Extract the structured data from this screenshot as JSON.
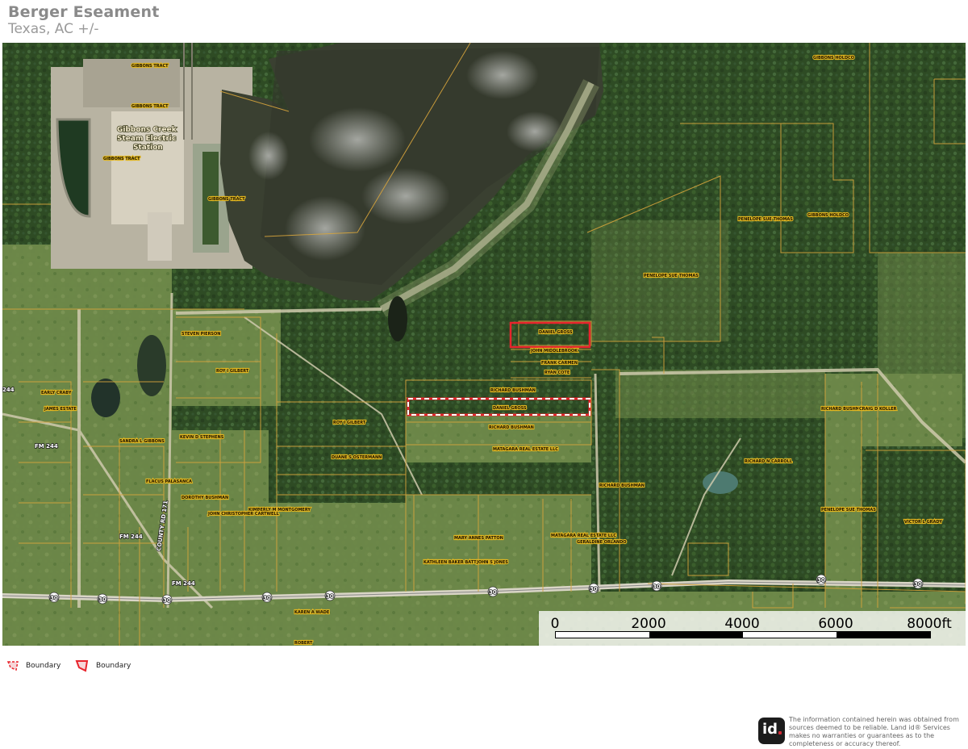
{
  "header": {
    "title": "Berger Eseament",
    "subtitle": "Texas,  AC +/-"
  },
  "map": {
    "place_labels": [
      "Gibbons Creek",
      "Steam Electric",
      "Station"
    ],
    "road_labels": [
      "FM 244",
      "FM 244",
      "FM 244",
      "COUNTY RD 171",
      "244",
      "30",
      "30",
      "30",
      "30",
      "30",
      "30",
      "30",
      "30",
      "30",
      "30"
    ],
    "parcel_labels": [
      "GIBBONS TRACT",
      "GIBBONS TRACT",
      "GIBBONS TRACT",
      "GIBBONS TRACT",
      "GIBBONS HOLDCO",
      "GIBBONS HOLDCO",
      "PENELOPE SUE THOMAS",
      "PENELOPE SUE THOMAS",
      "DANIEL GROSS",
      "JOHN MIDDLEBROOK",
      "FRANK CARMEN",
      "RYAN COTE",
      "RICHARD BUSHMAN",
      "DANIEL GROSS",
      "RICHARD BUSHMAN",
      "ROY I GILBERT",
      "MATAGARA REAL ESTATE LLC",
      "DUANE S OSTERMANN",
      "RICHARD BUSHMAN",
      "STEVEN PIERSON",
      "ROY I GILBERT",
      "KEVIN D STEPHENS",
      "JAMES ESTATE",
      "EARLY CRABY",
      "SANDRA L GIBBONS",
      "FLACUS PALASANCA",
      "KIMBERLY M MONTGOMERY",
      "JOHN CHRISTOPHER CARTWELL",
      "DOROTHY BUSHMAN",
      "GERALDINE ORLANDO",
      "MARY ANNES PATTON",
      "KATHLEEN BAKER BATTERFIELD",
      "JOHN S JONES",
      "MATAGARA REAL ESTATE LLC",
      "RICHARD N CARROLL",
      "RICHARD BUSHMAN",
      "CRAIG D KOLLER",
      "PENELOPE SUE THOMAS",
      "VICTOR L GRADY",
      "ROBERT",
      "KAREN A WADE"
    ],
    "boundary_primary_color": "#e8242c",
    "boundary_secondary_color": "#e8242c",
    "parcel_line_color": "#d6a43c"
  },
  "scale": {
    "labels": [
      "0",
      "2000",
      "4000",
      "6000",
      "8000ft"
    ]
  },
  "legend": {
    "items": [
      {
        "label": "Boundary",
        "style": "dashed"
      },
      {
        "label": "Boundary",
        "style": "solid"
      }
    ]
  },
  "footer": {
    "logo_text": "id",
    "disclaimer": "The information contained herein was obtained from sources deemed to be reliable. Land id® Services makes no warranties or guarantees as to the completeness or accuracy thereof."
  }
}
